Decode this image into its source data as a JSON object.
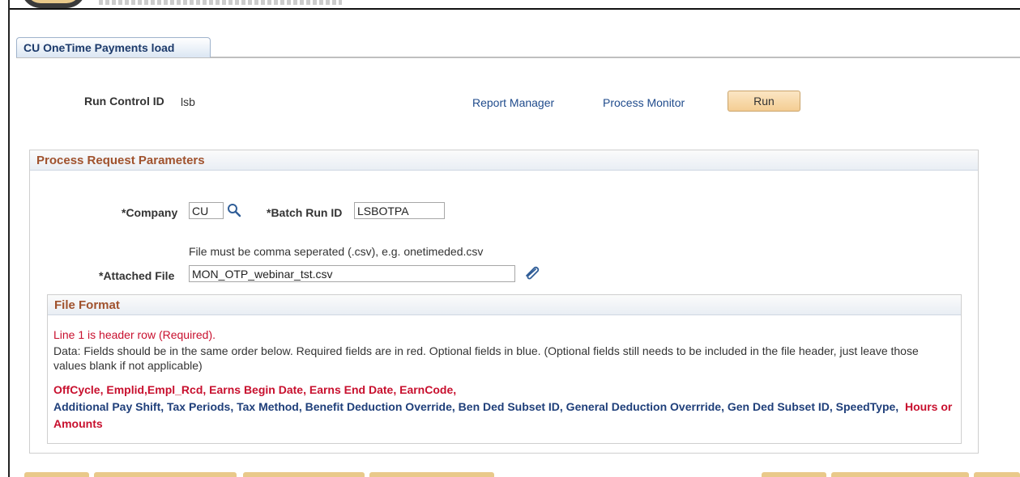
{
  "tab": {
    "label": "CU OneTime Payments load"
  },
  "run_control": {
    "label": "Run Control ID",
    "value": "lsb",
    "report_manager": "Report Manager",
    "process_monitor": "Process Monitor",
    "run_button": "Run"
  },
  "process_request": {
    "title": "Process Request Parameters",
    "company_label": "*Company",
    "company_value": "CU",
    "batch_label": "*Batch Run ID",
    "batch_value": "LSBOTPA",
    "file_note": "File must be comma seperated (.csv), e.g. onetimeded.csv",
    "attached_label": "*Attached File",
    "attached_value": "MON_OTP_webinar_tst.csv"
  },
  "file_format": {
    "title": "File Format",
    "line1": "Line 1 is header row (Required).",
    "data_desc": "Data: Fields should be in the same order below. Required fields are in red. Optional fields in blue. (Optional fields still needs to be included in the file header, just leave those values blank if not applicable)",
    "required_fields_1": "OffCycle, Emplid,Empl_Rcd, Earns Begin Date, Earns End Date, EarnCode,",
    "optional_fields": "Additional Pay Shift, Tax Periods, Tax Method, Benefit Deduction Override, Ben Ded Subset ID, General Deduction Overrride, Gen Ded Subset ID, SpeedType,",
    "required_fields_2": "Hours or Amounts"
  },
  "colors": {
    "required": "#c8102e",
    "optional": "#1f3f7a",
    "section_title": "#a0522d",
    "link": "#1f4b8c"
  },
  "icons": {
    "lookup": "magnifier-icon",
    "attach": "paperclip-icon"
  }
}
